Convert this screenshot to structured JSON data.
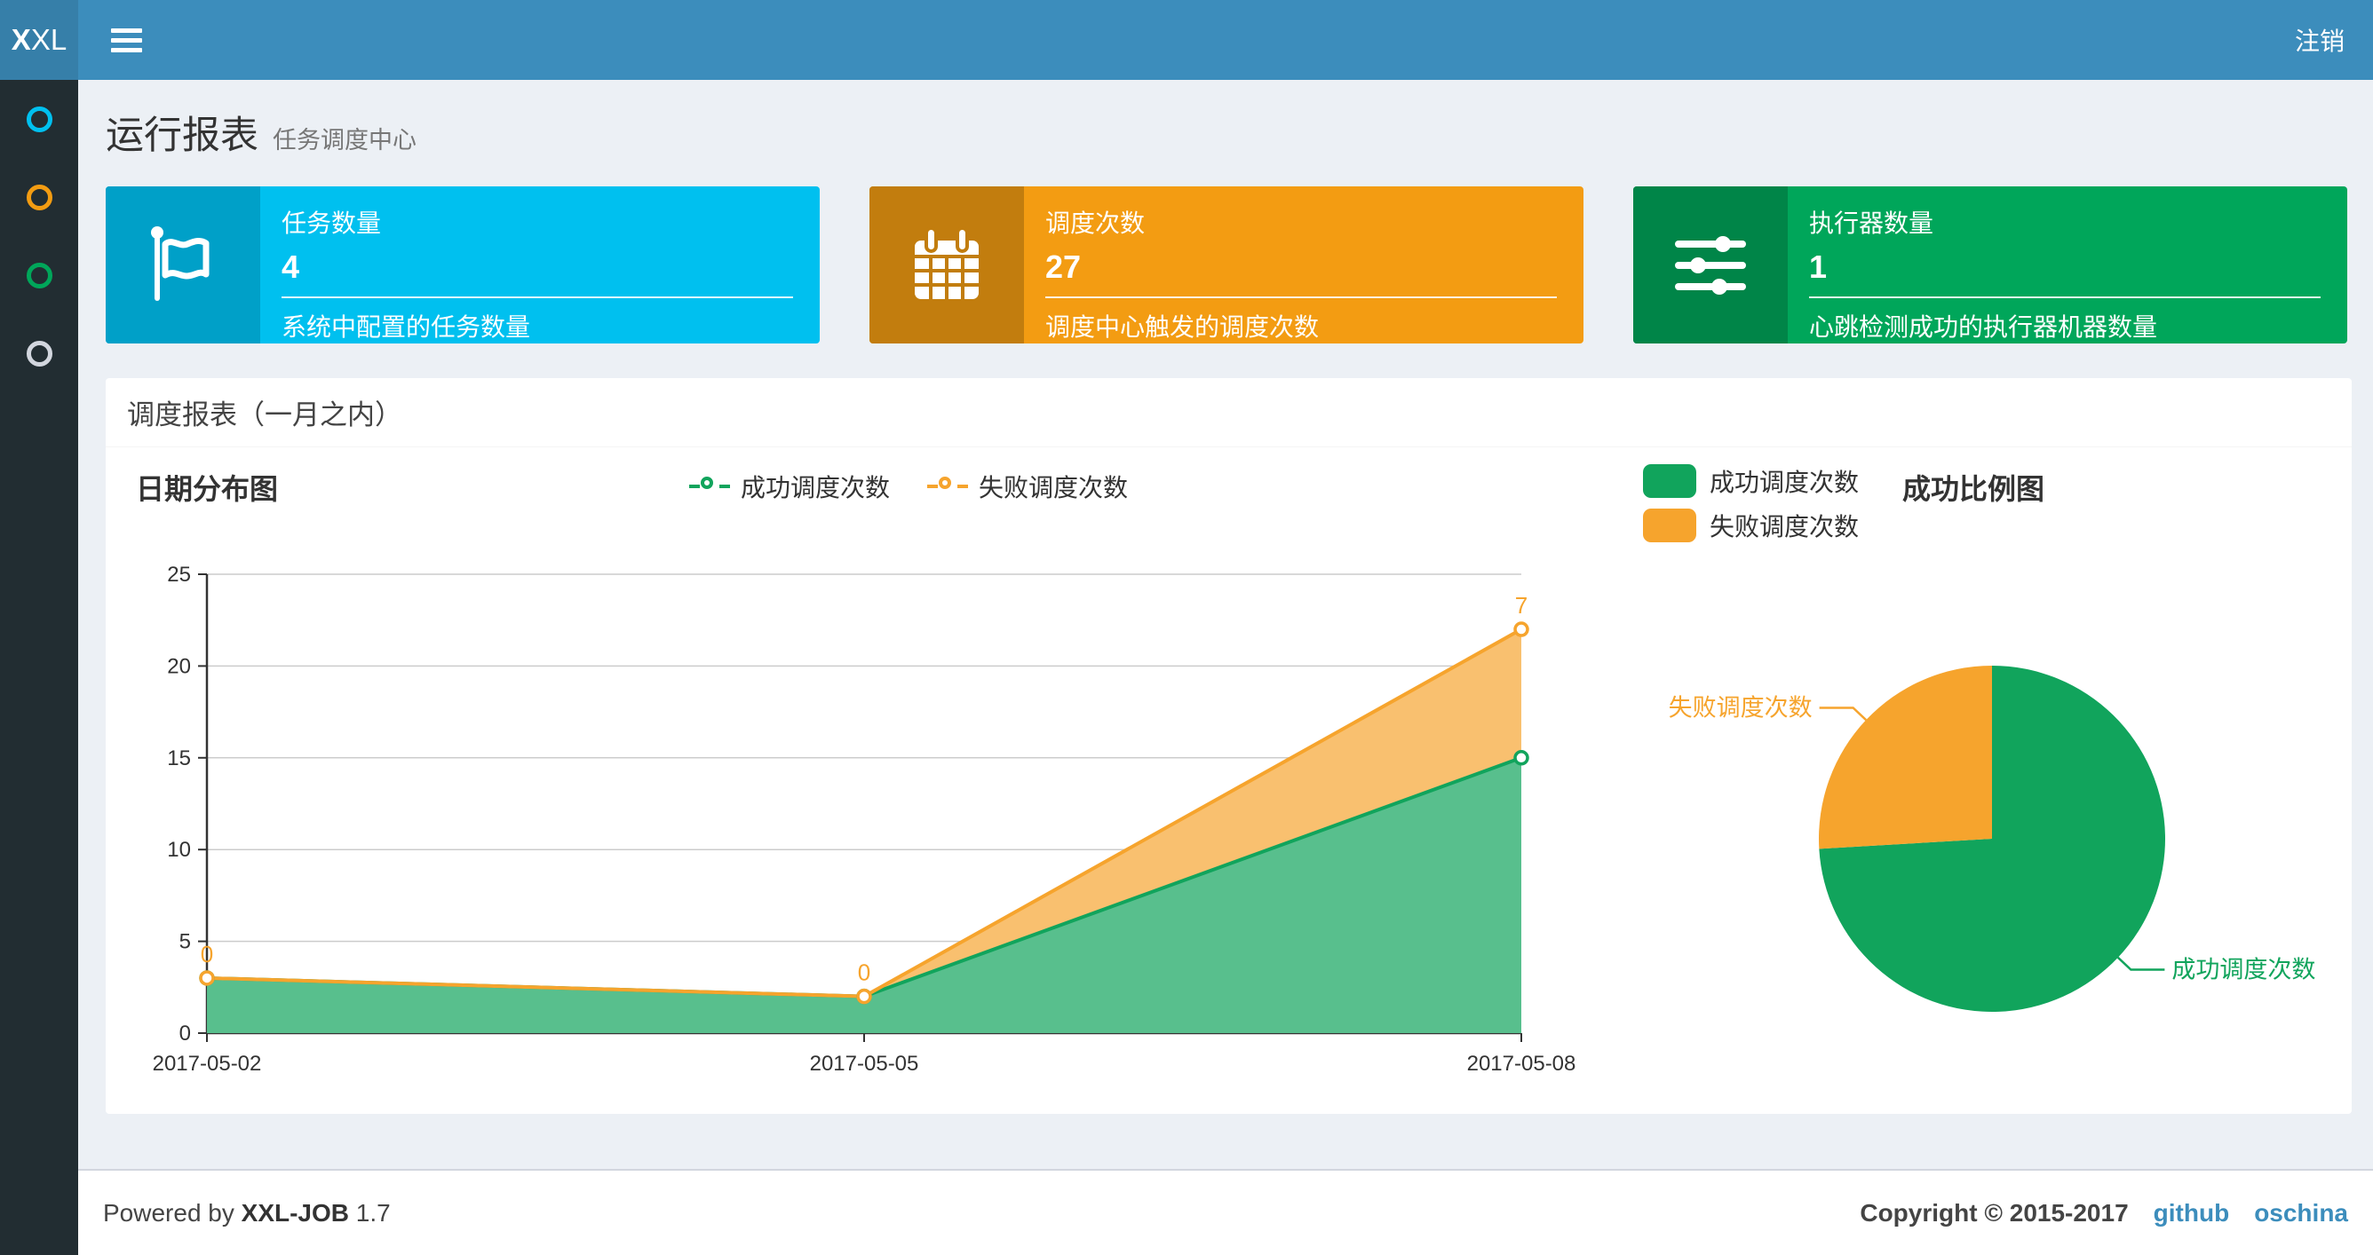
{
  "navbar": {
    "logo_bold": "X",
    "logo_rest": "XL",
    "logout_label": "注销"
  },
  "sidebar": {
    "items": [
      {
        "name": "menu-dashboard",
        "icon": "circle-icon",
        "color": "#00c0ef"
      },
      {
        "name": "menu-jobs",
        "icon": "circle-icon",
        "color": "#f39c12"
      },
      {
        "name": "menu-logs",
        "icon": "circle-icon",
        "color": "#00a65a"
      },
      {
        "name": "menu-executors",
        "icon": "circle-icon",
        "color": "#d2d6de"
      }
    ]
  },
  "page_header": {
    "title": "运行报表",
    "subtitle": "任务调度中心"
  },
  "stat_boxes": [
    {
      "label": "任务数量",
      "value": "4",
      "description": "系统中配置的任务数量",
      "color": "#00c0ef",
      "icon_bg": "#00a0c8",
      "icon": "flag-icon"
    },
    {
      "label": "调度次数",
      "value": "27",
      "description": "调度中心触发的调度次数",
      "color": "#f39c12",
      "icon_bg": "#c27d0e",
      "icon": "calendar-icon"
    },
    {
      "label": "执行器数量",
      "value": "1",
      "description": "心跳检测成功的执行器机器数量",
      "color": "#00a65a",
      "icon_bg": "#008548",
      "icon": "sliders-icon"
    }
  ],
  "panel": {
    "title": "调度报表（一月之内）"
  },
  "chart_data": [
    {
      "type": "area",
      "title": "日期分布图",
      "categories": [
        "2017-05-02",
        "2017-05-05",
        "2017-05-08"
      ],
      "series": [
        {
          "name": "成功调度次数",
          "values": [
            3,
            2,
            15
          ],
          "color": "#11A45C",
          "area_color": "#58BF8D",
          "stack": true
        },
        {
          "name": "失败调度次数",
          "values": [
            0,
            0,
            7
          ],
          "color": "#F6A42D",
          "area_color": "#F9C06F",
          "stack": true,
          "point_labels": [
            "0",
            "0",
            "7"
          ]
        }
      ],
      "ylim": [
        0,
        25
      ],
      "yticks": [
        0,
        5,
        10,
        15,
        20,
        25
      ],
      "grid": true,
      "legend_position": "top-center"
    },
    {
      "type": "pie",
      "title": "成功比例图",
      "legend_position": "top-left",
      "slices": [
        {
          "name": "成功调度次数",
          "value": 20,
          "color": "#11A45C"
        },
        {
          "name": "失败调度次数",
          "value": 7,
          "color": "#F6A42D"
        }
      ],
      "start_angle": 90,
      "total": 27
    }
  ],
  "footer": {
    "powered_prefix": "Powered by",
    "brand": "XXL-JOB",
    "version": "1.7",
    "copyright": "Copyright © 2015-2017",
    "links": [
      {
        "label": "github"
      },
      {
        "label": "oschina"
      }
    ]
  }
}
